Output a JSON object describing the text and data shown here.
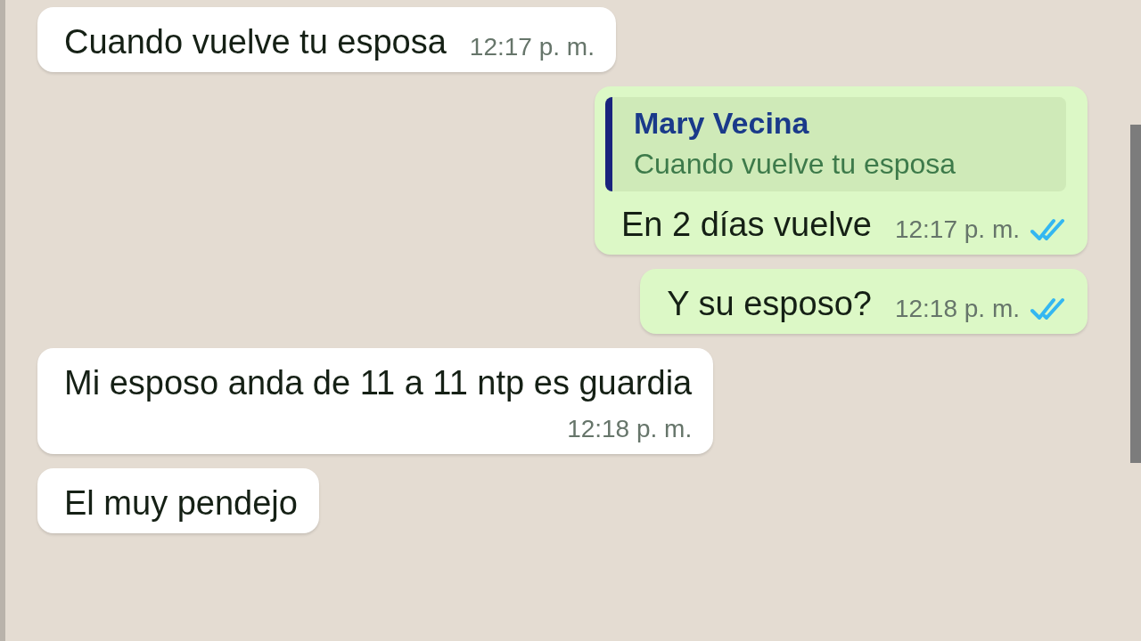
{
  "messages": [
    {
      "kind": "incoming",
      "text": "Cuando vuelve tu esposa",
      "time": "12:17 p. m."
    },
    {
      "kind": "outgoing",
      "quote": {
        "author": "Mary Vecina",
        "text": "Cuando vuelve tu esposa"
      },
      "text": "En 2 días vuelve",
      "time": "12:17 p. m.",
      "read": true
    },
    {
      "kind": "outgoing",
      "text": "Y su esposo?",
      "time": "12:18 p. m.",
      "read": true
    },
    {
      "kind": "incoming",
      "text": "Mi esposo anda de 11 a 11 ntp es guardia",
      "time": "12:18 p. m.",
      "wrapTime": true
    },
    {
      "kind": "incoming",
      "text": "El muy pendejo"
    }
  ]
}
